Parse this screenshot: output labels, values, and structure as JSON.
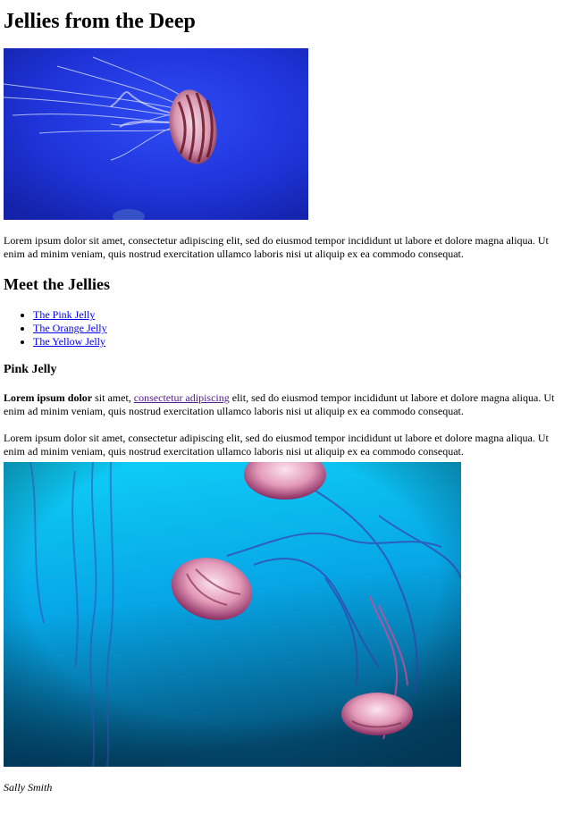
{
  "page": {
    "title": "Jellies from the Deep",
    "intro": "Lorem ipsum dolor sit amet, consectetur adipiscing elit, sed do eiusmod tempor incididunt ut labore et dolore magna aliqua. Ut enim ad minim veniam, quis nostrud exercitation ullamco laboris nisi ut aliquip ex ea commodo consequat.",
    "section_title": "Meet the Jellies",
    "links": [
      {
        "label": "The Pink Jelly"
      },
      {
        "label": "The Orange Jelly"
      },
      {
        "label": "The Yellow Jelly"
      }
    ],
    "subsection_title": "Pink Jelly",
    "para2_bold": "Lorem ipsum dolor",
    "para2_mid": " sit amet, ",
    "para2_link": "consectetur adipiscing",
    "para2_rest": " elit, sed do eiusmod tempor incididunt ut labore et dolore magna aliqua. Ut enim ad minim veniam, quis nostrud exercitation ullamco laboris nisi ut aliquip ex ea commodo consequat.",
    "para3": "Lorem ipsum dolor sit amet, consectetur adipiscing elit, sed do eiusmod tempor incididunt ut labore et dolore magna aliqua. Ut enim ad minim veniam, quis nostrud exercitation ullamco laboris nisi ut aliquip ex ea commodo consequat.",
    "credit": "Sally Smith"
  },
  "colors": {
    "link": "#0000ee",
    "visited_link": "#551a8b",
    "hero_water": "#1a2fe0",
    "deep_water": "#0aa6e8"
  },
  "images": {
    "hero_icon": "jellyfish-photo-icon",
    "second_icon": "jellyfish-group-photo-icon"
  }
}
